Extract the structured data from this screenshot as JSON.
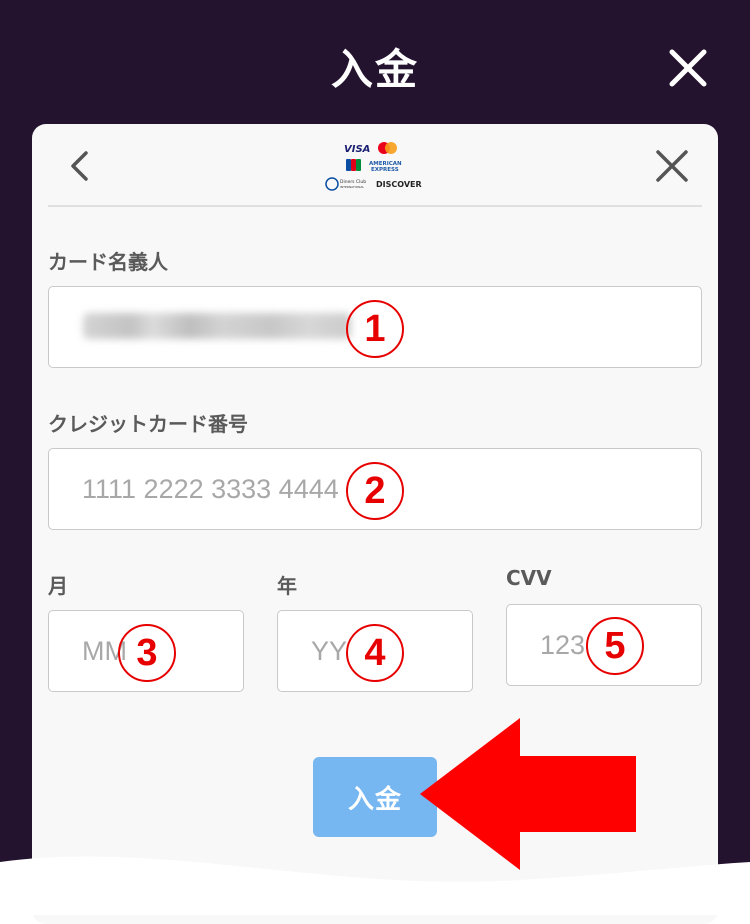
{
  "header": {
    "title": "入金",
    "close_icon": "close-icon"
  },
  "card": {
    "back_icon": "chevron-left-icon",
    "close_icon": "close-icon",
    "brands": {
      "visa": "VISA",
      "amex_line1": "AMERICAN",
      "amex_line2": "EXPRESS",
      "jcb": "JCB",
      "diners_line1": "Diners Club",
      "diners_line2": "INTERNATIONAL",
      "discover": "DISCOVER"
    }
  },
  "form": {
    "name_label": "カード名義人",
    "name_value": "",
    "card_number_label": "クレジットカード番号",
    "card_number_placeholder": "1111 2222 3333 4444",
    "month_label": "月",
    "month_placeholder": "MM",
    "year_label": "年",
    "year_placeholder": "YY",
    "cvv_label": "CVV",
    "cvv_placeholder": "123",
    "submit_label": "入金"
  },
  "annotations": {
    "markers": [
      "1",
      "2",
      "3",
      "4",
      "5"
    ],
    "marker_color": "#e60000",
    "arrow_color": "#ff0000"
  },
  "colors": {
    "header_bg": "#24132f",
    "card_bg": "#f8f8f8",
    "submit_bg": "#76b6f1"
  }
}
